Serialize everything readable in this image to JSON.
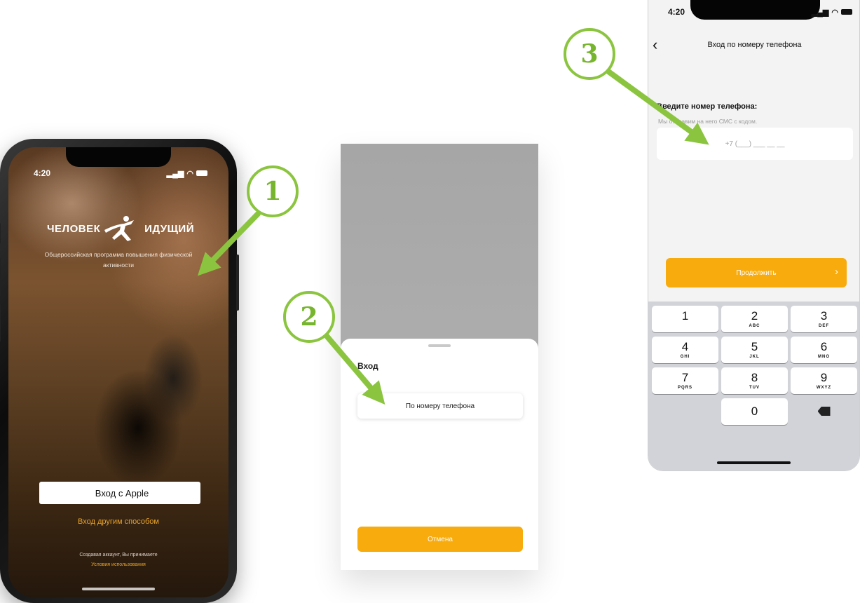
{
  "steps": {
    "one": "1",
    "two": "2",
    "three": "3"
  },
  "screen1": {
    "time": "4:20",
    "logo_left": "ЧЕЛОВЕК",
    "logo_right": "ИДУЩИЙ",
    "tagline": "Общероссийская программа повышения физической активности",
    "apple_button": "Вход с Apple",
    "other_method": "Вход другим способом",
    "terms_line1": "Создавая аккаунт, Вы принимаете",
    "terms_link": "Условия использования"
  },
  "screen2": {
    "title": "Вход",
    "phone_option": "По номеру телефона",
    "cancel": "Отмена"
  },
  "screen3": {
    "time": "4:20",
    "nav_title": "Вход по номеру телефона",
    "enter_label": "Введите номер телефона:",
    "sms_hint": "Мы отправим на него СМС с кодом.",
    "phone_placeholder": "+7 (___) ___ __ __",
    "continue": "Продолжить",
    "keys": [
      {
        "num": "1",
        "letters": ""
      },
      {
        "num": "2",
        "letters": "ABC"
      },
      {
        "num": "3",
        "letters": "DEF"
      },
      {
        "num": "4",
        "letters": "GHI"
      },
      {
        "num": "5",
        "letters": "JKL"
      },
      {
        "num": "6",
        "letters": "MNO"
      },
      {
        "num": "7",
        "letters": "PQRS"
      },
      {
        "num": "8",
        "letters": "TUV"
      },
      {
        "num": "9",
        "letters": "WXYZ"
      },
      {
        "num": "0",
        "letters": ""
      }
    ]
  },
  "colors": {
    "accent": "#f7ab0c",
    "callout": "#8bc53f"
  }
}
